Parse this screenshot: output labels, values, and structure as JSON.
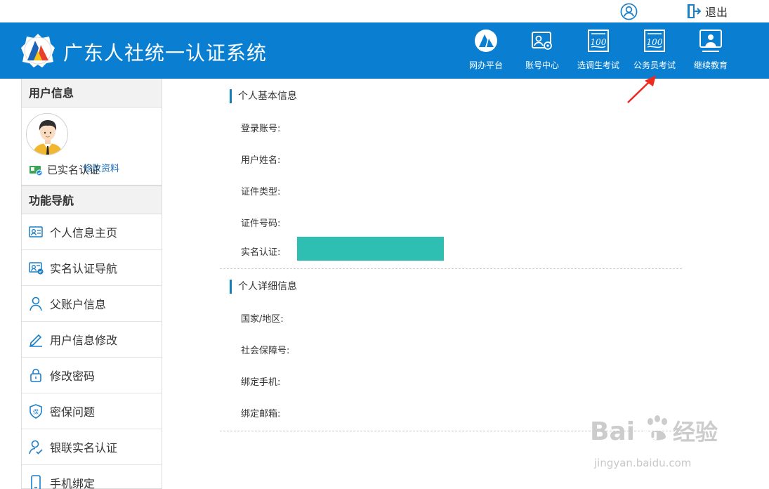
{
  "topbar": {
    "user_icon": "user-circle-icon",
    "logout_icon": "logout-door-icon",
    "logout_label": "退出"
  },
  "header": {
    "title": "广东人社统一认证系统",
    "background_color": "#0a7fd1",
    "nav": [
      {
        "label": "网办平台",
        "icon": "portal-emblem-icon"
      },
      {
        "label": "账号中心",
        "icon": "account-card-gear-icon"
      },
      {
        "label": "选调生考试",
        "icon": "exam-score-100-icon"
      },
      {
        "label": "公务员考试",
        "icon": "exam-score-100-icon"
      },
      {
        "label": "继续教育",
        "icon": "lecture-board-icon"
      }
    ]
  },
  "sidebar": {
    "user_section": "用户信息",
    "edit_profile": "修改资料",
    "verified_status": "已实名认证",
    "nav_section": "功能导航",
    "menu": [
      {
        "label": "个人信息主页",
        "icon": "id-card-icon"
      },
      {
        "label": "实名认证导航",
        "icon": "id-verify-icon"
      },
      {
        "label": "父账户信息",
        "icon": "person-outline-icon"
      },
      {
        "label": "用户信息修改",
        "icon": "pencil-icon"
      },
      {
        "label": "修改密码",
        "icon": "lock-icon"
      },
      {
        "label": "密保问题",
        "icon": "shield-bao-icon"
      },
      {
        "label": "银联实名认证",
        "icon": "person-check-icon"
      },
      {
        "label": "手机绑定",
        "icon": "mobile-phone-icon"
      }
    ]
  },
  "main": {
    "basic_title": "个人基本信息",
    "basic_fields": [
      "登录账号:",
      "用户姓名:",
      "证件类型:",
      "证件号码:",
      "实名认证:"
    ],
    "detail_title": "个人详细信息",
    "detail_fields": [
      "国家/地区:",
      "社会保障号:",
      "绑定手机:",
      "绑定邮箱:"
    ],
    "accent_color": "#137fb3",
    "realname_highlight_color": "#2ebfb2"
  },
  "watermark": {
    "brand": "Bai",
    "brand_suffix": "du",
    "product": "经验",
    "url": "jingyan.baidu.com"
  }
}
